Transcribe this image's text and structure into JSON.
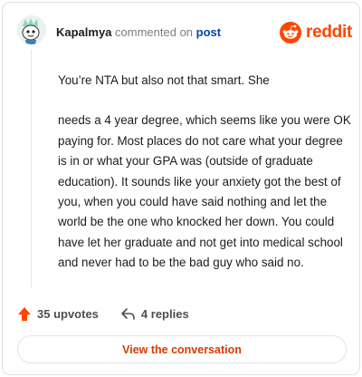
{
  "comment": {
    "username": "Kapalmya",
    "action_text": "commented on",
    "post_link": "post",
    "paragraphs": [
      "You’re NTA but also not that smart. She",
      "needs a 4 year degree, which seems like you were OK paying for. Most places do not care what your degree is in or what your GPA was (outside of graduate education). It sounds like your anxiety got the best of you, when you could have said nothing and let the world be the one who knocked her down. You could have let her graduate and not get into medical school and never had to be the bad guy who said no."
    ],
    "upvotes": "35 upvotes",
    "replies": "4 replies"
  },
  "brand": {
    "name": "reddit",
    "icon": "reddit-logo-icon"
  },
  "cta": {
    "label": "View the conversation"
  },
  "colors": {
    "accent": "#ff4500",
    "link": "#0045ac",
    "cta_text": "#d93a00"
  }
}
